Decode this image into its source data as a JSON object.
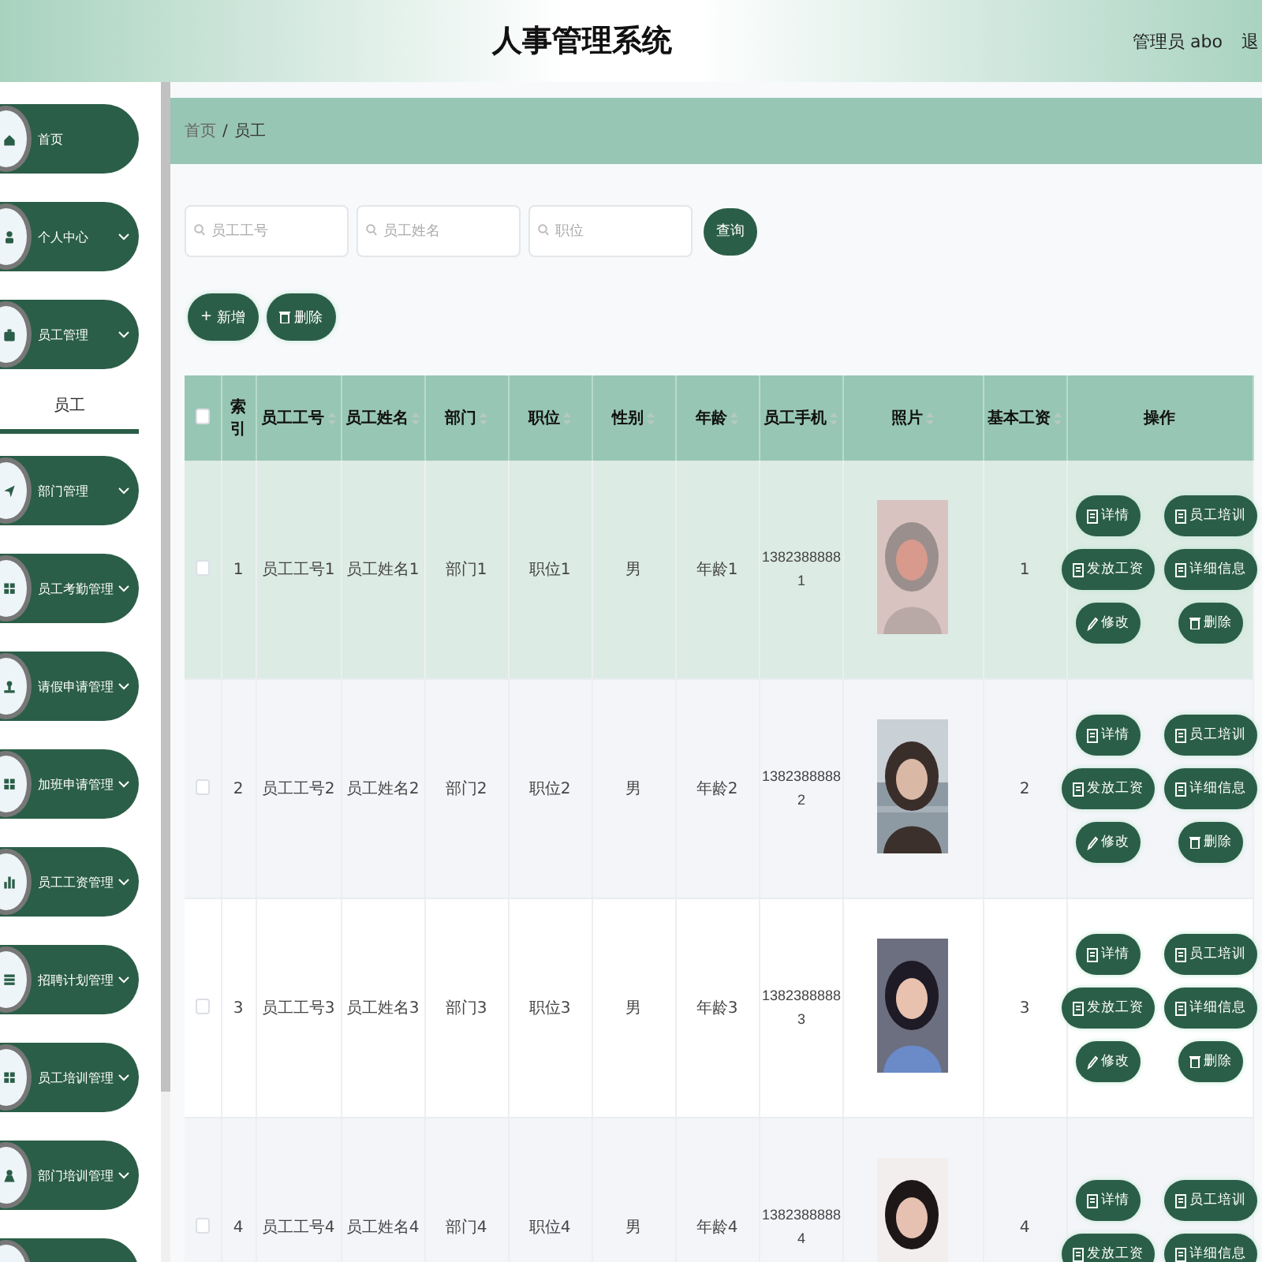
{
  "header": {
    "title": "人事管理系统",
    "user": "管理员 abo",
    "logout": "退"
  },
  "sidebar": {
    "items": [
      {
        "label": "首页",
        "has_submenu": false
      },
      {
        "label": "个人中心",
        "has_submenu": true
      },
      {
        "label": "员工管理",
        "has_submenu": true,
        "children": [
          {
            "label": "员工",
            "selected": true
          }
        ]
      },
      {
        "label": "部门管理",
        "has_submenu": true
      },
      {
        "label": "员工考勤管理",
        "has_submenu": true
      },
      {
        "label": "请假申请管理",
        "has_submenu": true
      },
      {
        "label": "加班申请管理",
        "has_submenu": true
      },
      {
        "label": "员工工资管理",
        "has_submenu": true
      },
      {
        "label": "招聘计划管理",
        "has_submenu": true
      },
      {
        "label": "员工培训管理",
        "has_submenu": true
      },
      {
        "label": "部门培训管理",
        "has_submenu": true
      }
    ]
  },
  "breadcrumb": [
    "首页",
    "/",
    "员工"
  ],
  "search": {
    "fields": [
      {
        "placeholder": "员工工号"
      },
      {
        "placeholder": "员工姓名"
      },
      {
        "placeholder": "职位"
      }
    ],
    "button": "查询"
  },
  "toolbar": [
    {
      "kind": "add",
      "icon": "+",
      "label": "新增"
    },
    {
      "kind": "delete",
      "label": "删除"
    }
  ],
  "table": {
    "all_checked": false,
    "columns": [
      {
        "label": "索引",
        "sortable": false
      },
      {
        "label": "员工工号",
        "sortable": true
      },
      {
        "label": "员工姓名",
        "sortable": true
      },
      {
        "label": "部门",
        "sortable": true
      },
      {
        "label": "职位",
        "sortable": true
      },
      {
        "label": "性别",
        "sortable": true
      },
      {
        "label": "年龄",
        "sortable": true
      },
      {
        "label": "员工手机",
        "sortable": true
      },
      {
        "label": "照片",
        "sortable": true
      },
      {
        "label": "基本工资",
        "sortable": true
      },
      {
        "label": "操作",
        "sortable": false
      }
    ],
    "rows": [
      {
        "highlighted": true,
        "checked": false,
        "cells": [
          "1",
          "员工工号1",
          "员工姓名1",
          "部门1",
          "职位1",
          "男",
          "年龄1",
          "13823888881"
        ],
        "salary": "1",
        "actions": [
          {
            "kind": "doc",
            "label": "详情"
          },
          {
            "kind": "doc",
            "label": "员工培训"
          },
          {
            "kind": "doc",
            "label": "发放工资"
          },
          {
            "kind": "doc",
            "label": "详细信息"
          },
          {
            "kind": "edit",
            "label": "修改"
          },
          {
            "kind": "delete",
            "label": "删除"
          }
        ]
      },
      {
        "highlighted": false,
        "checked": false,
        "cells": [
          "2",
          "员工工号2",
          "员工姓名2",
          "部门2",
          "职位2",
          "男",
          "年龄2",
          "13823888882"
        ],
        "salary": "2",
        "actions": [
          {
            "kind": "doc",
            "label": "详情"
          },
          {
            "kind": "doc",
            "label": "员工培训"
          },
          {
            "kind": "doc",
            "label": "发放工资"
          },
          {
            "kind": "doc",
            "label": "详细信息"
          },
          {
            "kind": "edit",
            "label": "修改"
          },
          {
            "kind": "delete",
            "label": "删除"
          }
        ]
      },
      {
        "highlighted": false,
        "checked": false,
        "cells": [
          "3",
          "员工工号3",
          "员工姓名3",
          "部门3",
          "职位3",
          "男",
          "年龄3",
          "13823888883"
        ],
        "salary": "3",
        "actions": [
          {
            "kind": "doc",
            "label": "详情"
          },
          {
            "kind": "doc",
            "label": "员工培训"
          },
          {
            "kind": "doc",
            "label": "发放工资"
          },
          {
            "kind": "doc",
            "label": "详细信息"
          },
          {
            "kind": "edit",
            "label": "修改"
          },
          {
            "kind": "delete",
            "label": "删除"
          }
        ]
      },
      {
        "highlighted": false,
        "checked": false,
        "cells": [
          "4",
          "员工工号4",
          "员工姓名4",
          "部门4",
          "职位4",
          "男",
          "年龄4",
          "13823888884"
        ],
        "salary": "4",
        "actions": [
          {
            "kind": "doc",
            "label": "详情"
          },
          {
            "kind": "doc",
            "label": "员工培训"
          },
          {
            "kind": "doc",
            "label": "发放工资"
          },
          {
            "kind": "doc",
            "label": "详细信息"
          }
        ]
      }
    ]
  }
}
